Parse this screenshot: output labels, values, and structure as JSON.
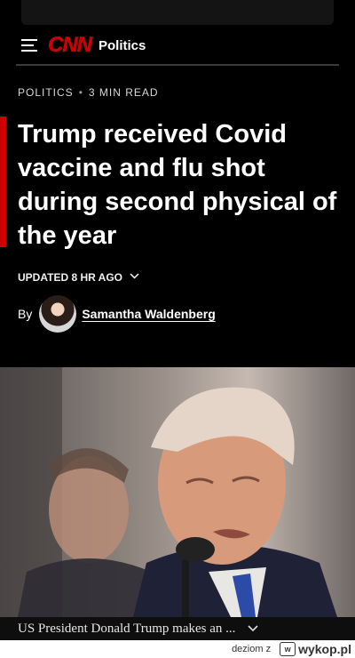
{
  "header": {
    "logo": "CNN",
    "section": "Politics"
  },
  "article": {
    "eyebrow_section": "POLITICS",
    "eyebrow_separator": "•",
    "read_time": "3 MIN READ",
    "headline": "Trump received Covid vaccine and flu shot during second physical of the year",
    "updated": "UPDATED 8 HR AGO",
    "by_label": "By",
    "author": "Samantha Waldenberg"
  },
  "photo": {
    "caption": "US President Donald Trump makes an ..."
  },
  "footer": {
    "user": "deziom z",
    "brand": "wykop.pl"
  },
  "colors": {
    "accent": "#cc0000",
    "background": "#000000"
  }
}
